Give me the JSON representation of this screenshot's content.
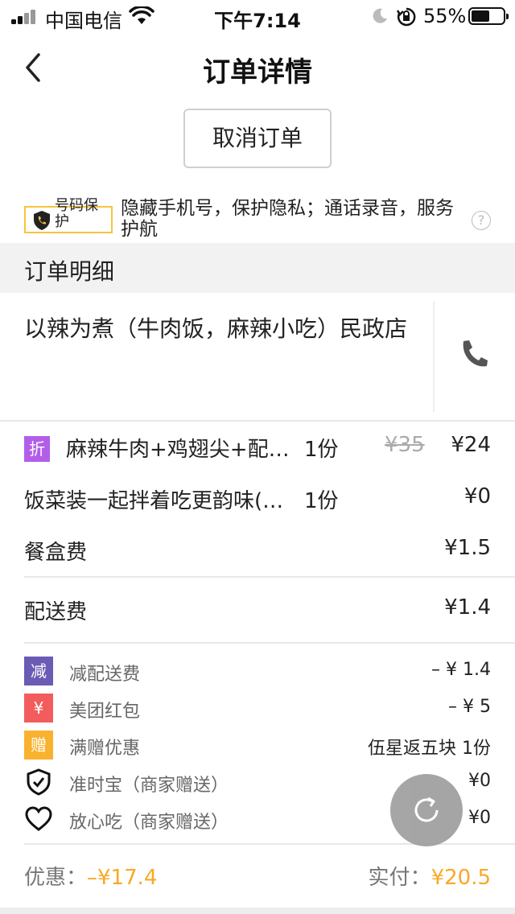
{
  "status_bar": {
    "carrier": "中国电信",
    "time": "下午7:14",
    "battery_percent": "55%"
  },
  "nav": {
    "title": "订单详情"
  },
  "actions": {
    "cancel_label": "取消订单"
  },
  "privacy": {
    "badge_label": "号码保护",
    "description": "隐藏手机号，保护隐私；通话录音，服务护航",
    "help_label": "?"
  },
  "section": {
    "title": "订单明细"
  },
  "shop": {
    "name": "以辣为煮（牛肉饭，麻辣小吃）民政店"
  },
  "items": [
    {
      "tag": "折",
      "name": "麻辣牛肉+鸡翅尖+配…",
      "qty": "1份",
      "original_price": "¥35",
      "price": "¥24"
    },
    {
      "name": "饭菜装一起拌着吃更韵味(…",
      "qty": "1份",
      "price": "¥0"
    }
  ],
  "fees": [
    {
      "name": "餐盒费",
      "price": "¥1.5"
    },
    {
      "name": "配送费",
      "price": "¥1.4"
    }
  ],
  "discounts": [
    {
      "tag": "减",
      "name": "减配送费",
      "value": "– ¥ 1.4",
      "color": "#6b5bb5"
    },
    {
      "tag": "¥",
      "name": "美团红包",
      "value": "– ¥ 5",
      "color": "#f25c5c"
    },
    {
      "tag": "赠",
      "name": "满赠优惠",
      "value": "伍星返五块 1份",
      "color": "#f9b22d"
    },
    {
      "icon": "shield-check-icon",
      "name": "准时宝（商家赠送）",
      "value": "¥0"
    },
    {
      "icon": "heart-outline-icon",
      "name": "放心吃（商家赠送）",
      "value": "¥0"
    }
  ],
  "totals": {
    "discount_label": "优惠：",
    "discount_value": "–¥17.4",
    "paid_label": "实付：",
    "paid_value": "¥20.5",
    "accent_color": "#f9a825"
  }
}
